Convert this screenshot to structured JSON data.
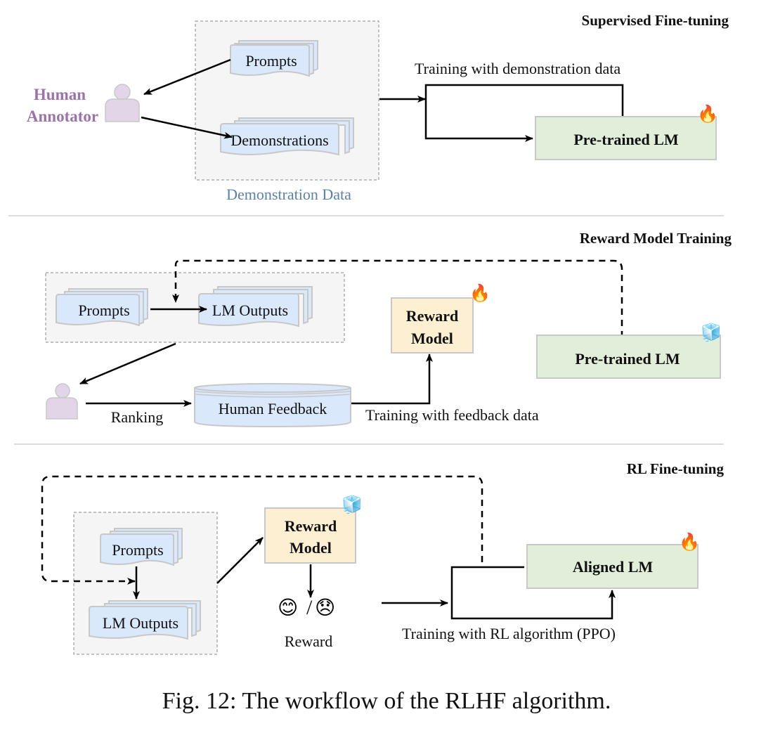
{
  "caption": "Fig. 12: The workflow of the RLHF algorithm.",
  "sections": {
    "sft": {
      "title": "Supervised Fine-tuning",
      "annotator_label_line1": "Human",
      "annotator_label_line2": "Annotator",
      "prompts": "Prompts",
      "demonstrations": "Demonstrations",
      "group_label": "Demonstration Data",
      "edge_label": "Training with demonstration data",
      "model": "Pre-trained LM",
      "model_state": "trainable",
      "model_state_icon": "🔥"
    },
    "rm": {
      "title": "Reward Model Training",
      "prompts": "Prompts",
      "lm_outputs": "LM Outputs",
      "ranking_label": "Ranking",
      "feedback_db": "Human Feedback",
      "edge_label": "Training with feedback data",
      "reward_model_line1": "Reward",
      "reward_model_line2": "Model",
      "reward_model_state": "trainable",
      "reward_model_state_icon": "🔥",
      "frozen_model": "Pre-trained LM",
      "frozen_model_state": "frozen",
      "frozen_model_state_icon": "🧊"
    },
    "rl": {
      "title": "RL Fine-tuning",
      "prompts": "Prompts",
      "lm_outputs": "LM Outputs",
      "reward_model_line1": "Reward",
      "reward_model_line2": "Model",
      "reward_model_state": "frozen",
      "reward_model_state_icon": "🧊",
      "reward_happy_icon": "😊",
      "reward_separator": "/",
      "reward_sad_icon": "😞",
      "reward_label": "Reward",
      "edge_label": "Training with RL algorithm (PPO)",
      "model": "Aligned LM",
      "model_state": "trainable",
      "model_state_icon": "🔥"
    }
  },
  "colors": {
    "doc_fill": "#dae8fc",
    "doc_stroke": "#c8c8c8",
    "group_fill": "#f5f5f5",
    "lm_fill": "#e1eed9",
    "reward_fill": "#fdf0d2",
    "person_fill": "#e1d5e7",
    "annotator_text": "#9b72aa",
    "group_text": "#5b7faf"
  }
}
